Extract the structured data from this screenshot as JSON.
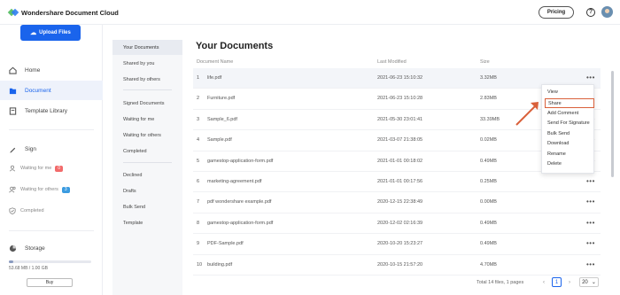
{
  "header": {
    "app_title": "Wondershare Document Cloud",
    "pricing_label": "Pricing",
    "help_label": "?"
  },
  "sidebar": {
    "upload_label": "Upload Files",
    "items": [
      {
        "label": "Home",
        "icon": "home-icon"
      },
      {
        "label": "Document",
        "icon": "folder-icon",
        "active": true
      },
      {
        "label": "Template Library",
        "icon": "template-icon"
      },
      {
        "label": "Sign",
        "icon": "pen-icon"
      }
    ],
    "sign_sub": [
      {
        "label": "Waiting for me",
        "badge": "0",
        "badge_color": "#f26b6b"
      },
      {
        "label": "Waiting for others",
        "badge": "3",
        "badge_color": "#3b9be0"
      },
      {
        "label": "Completed",
        "badge": ""
      }
    ],
    "storage_label": "Storage",
    "storage_text": "53.68 MB / 1.00 GB",
    "storage_fraction": 0.052,
    "buy_label": "Buy"
  },
  "subnav": {
    "items": [
      "Your Documents",
      "Shared by you",
      "Shared by others",
      "Signed Documents",
      "Waiting for me",
      "Waiting for others",
      "Completed",
      "Declined",
      "Drafts",
      "Bulk Send",
      "Template"
    ]
  },
  "main": {
    "title": "Your Documents",
    "columns": {
      "name": "Document Name",
      "modified": "Last Modified",
      "size": "Size"
    },
    "rows": [
      {
        "n": "1",
        "name": "life.pdf",
        "modified": "2021-06-23 15:10:32",
        "size": "3.32MB"
      },
      {
        "n": "2",
        "name": "Furniture.pdf",
        "modified": "2021-06-23 15:10:28",
        "size": "2.83MB"
      },
      {
        "n": "3",
        "name": "Sample_6.pdf",
        "modified": "2021-05-30 23:01:41",
        "size": "33.39MB"
      },
      {
        "n": "4",
        "name": "Sample.pdf",
        "modified": "2021-03-07 21:38:05",
        "size": "0.02MB"
      },
      {
        "n": "5",
        "name": "gamestop-application-form.pdf",
        "modified": "2021-01-01 00:18:02",
        "size": "0.49MB"
      },
      {
        "n": "6",
        "name": "marketing-agreement.pdf",
        "modified": "2021-01-01 00:17:56",
        "size": "0.25MB"
      },
      {
        "n": "7",
        "name": "pdf wondershare example.pdf",
        "modified": "2020-12-15 22:38:49",
        "size": "0.00MB"
      },
      {
        "n": "8",
        "name": "gamestop-application-form.pdf",
        "modified": "2020-12-02 02:16:39",
        "size": "0.49MB"
      },
      {
        "n": "9",
        "name": "PDF-Sample.pdf",
        "modified": "2020-10-20 15:23:27",
        "size": "0.49MB"
      },
      {
        "n": "10",
        "name": "building.pdf",
        "modified": "2020-10-15 21:57:20",
        "size": "4.70MB"
      }
    ],
    "row_menu_label": "•••"
  },
  "context_menu": {
    "items": [
      "View",
      "Share",
      "Add Comment",
      "Send For Signature",
      "Bulk Send",
      "Download",
      "Rename",
      "Delete"
    ],
    "highlight": "Share",
    "highlight_color": "#d9603a"
  },
  "pagination": {
    "total_text": "Total 14 files, 1 pages",
    "prev": "‹",
    "page": "1",
    "next": "›",
    "page_size": "20",
    "page_size_caret": "⌄"
  },
  "colors": {
    "accent": "#1a64ec",
    "active_bg": "#eef2fb"
  }
}
